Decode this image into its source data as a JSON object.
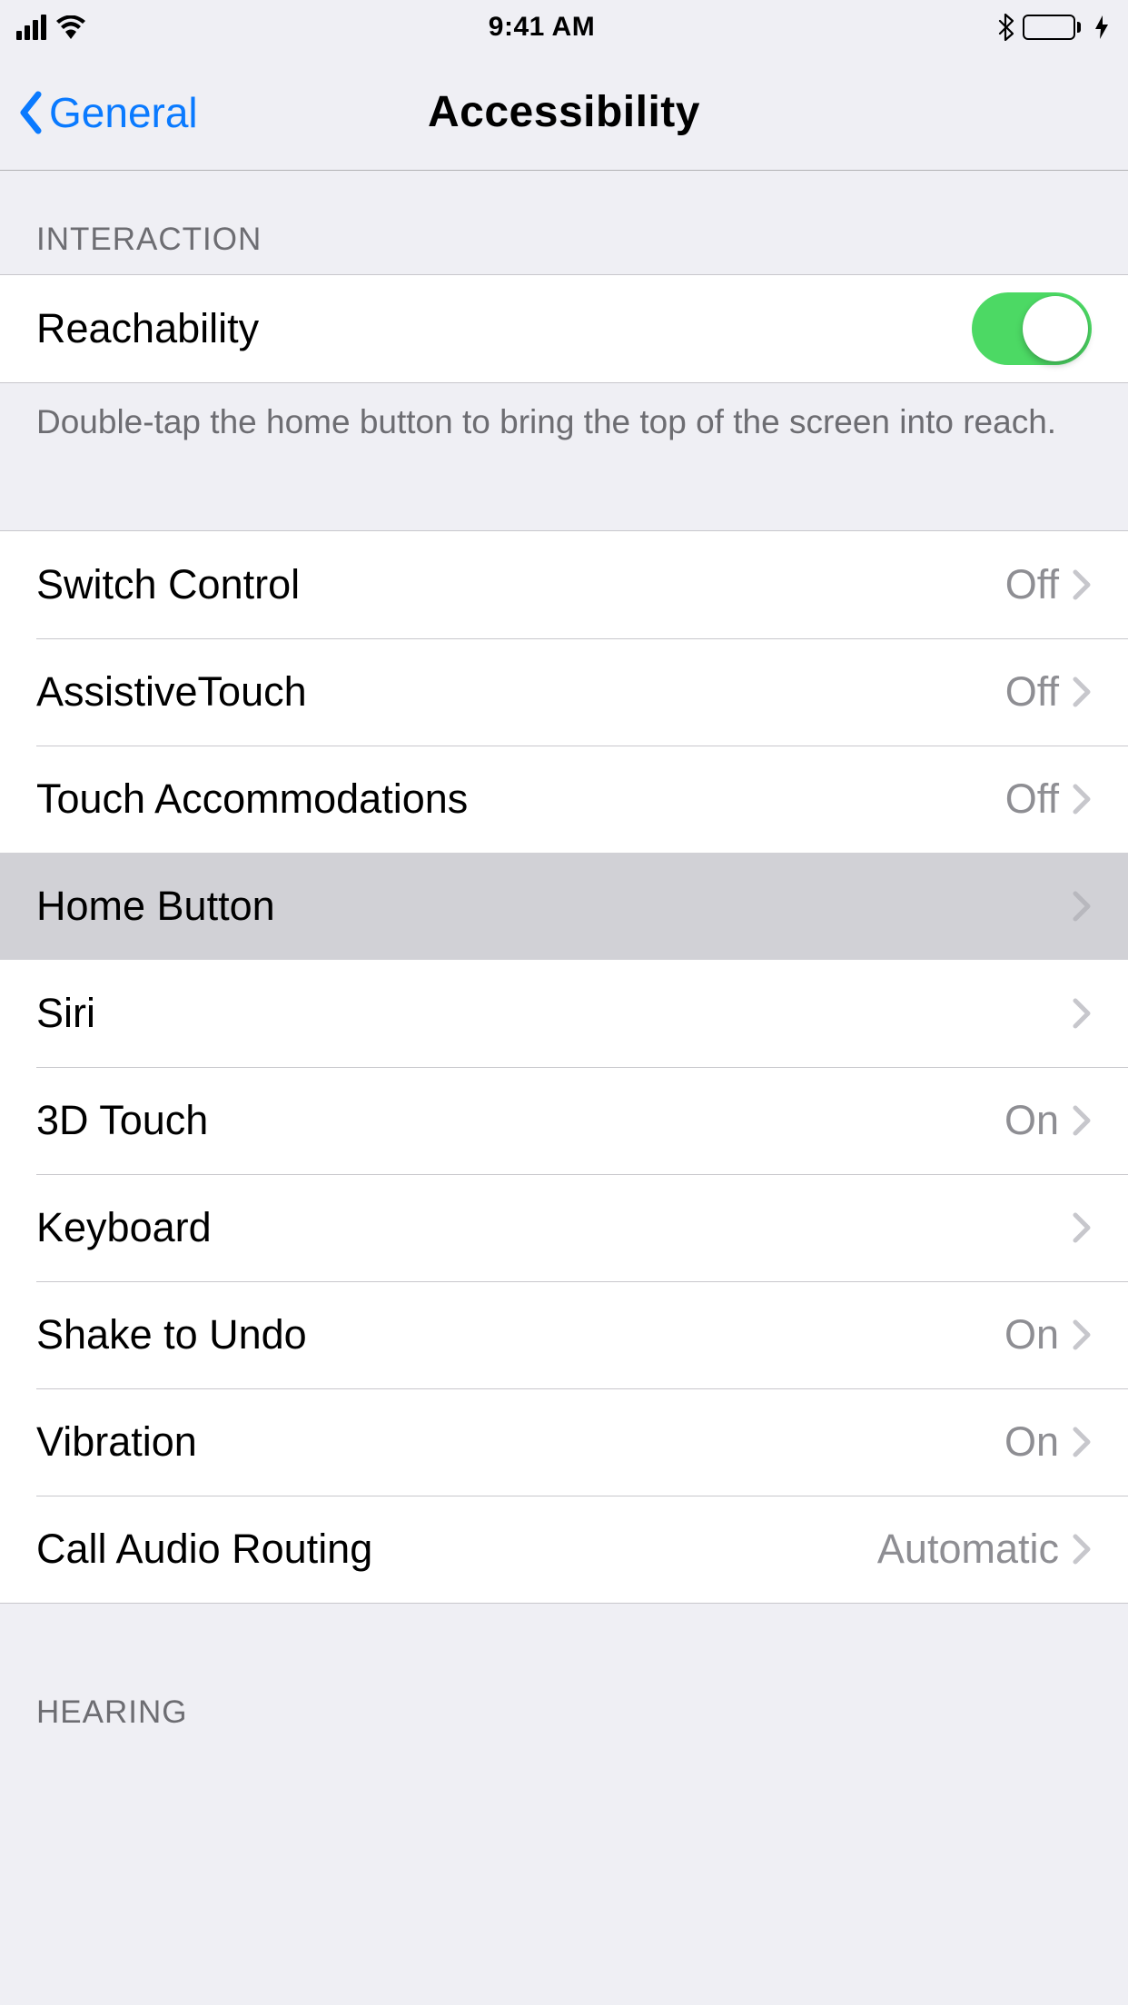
{
  "statusbar": {
    "time": "9:41 AM"
  },
  "nav": {
    "back": "General",
    "title": "Accessibility"
  },
  "sections": {
    "interaction": {
      "header": "Interaction",
      "reachability": {
        "label": "Reachability",
        "on": true
      },
      "footer": "Double-tap the home button to bring the top of the screen into reach.",
      "switch_control": {
        "label": "Switch Control",
        "value": "Off"
      },
      "assistivetouch": {
        "label": "AssistiveTouch",
        "value": "Off"
      },
      "touch_accommodations": {
        "label": "Touch Accommodations",
        "value": "Off"
      },
      "home_button": {
        "label": "Home Button",
        "value": ""
      },
      "siri": {
        "label": "Siri",
        "value": ""
      },
      "three_d_touch": {
        "label": "3D Touch",
        "value": "On"
      },
      "keyboard": {
        "label": "Keyboard",
        "value": ""
      },
      "shake_to_undo": {
        "label": "Shake to Undo",
        "value": "On"
      },
      "vibration": {
        "label": "Vibration",
        "value": "On"
      },
      "call_audio_routing": {
        "label": "Call Audio Routing",
        "value": "Automatic"
      }
    },
    "hearing": {
      "header": "Hearing"
    }
  }
}
